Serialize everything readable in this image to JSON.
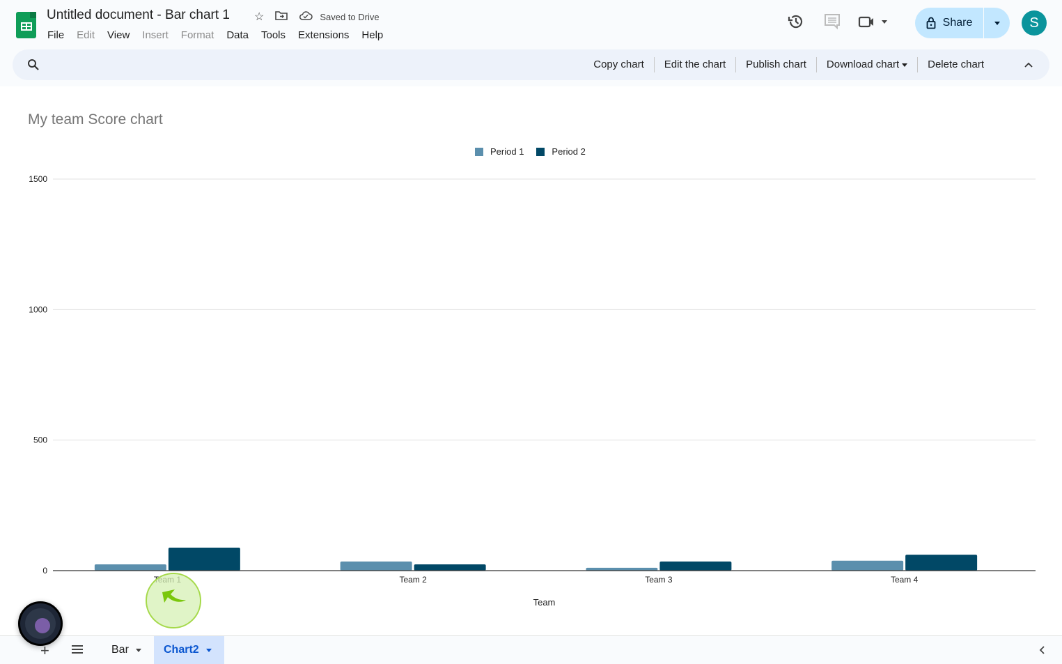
{
  "app": {
    "doc_title": "Untitled document - Bar chart 1",
    "saved_status": "Saved to Drive",
    "menu": [
      {
        "label": "File",
        "disabled": false
      },
      {
        "label": "Edit",
        "disabled": true
      },
      {
        "label": "View",
        "disabled": false
      },
      {
        "label": "Insert",
        "disabled": true
      },
      {
        "label": "Format",
        "disabled": true
      },
      {
        "label": "Data",
        "disabled": false
      },
      {
        "label": "Tools",
        "disabled": false
      },
      {
        "label": "Extensions",
        "disabled": false
      },
      {
        "label": "Help",
        "disabled": false
      }
    ],
    "share_label": "Share",
    "avatar_initial": "S",
    "avatar_color": "#0b949c"
  },
  "chart_toolbar": {
    "copy": "Copy chart",
    "edit": "Edit the chart",
    "publish": "Publish chart",
    "download": "Download chart",
    "delete": "Delete chart"
  },
  "sheets": {
    "tabs": [
      {
        "label": "Bar",
        "active": false
      },
      {
        "label": "Chart2",
        "active": true
      }
    ]
  },
  "chart_data": {
    "type": "bar",
    "title": "My team Score chart",
    "xlabel": "Team",
    "ylabel": "",
    "categories": [
      "Team 1",
      "Team 2",
      "Team 3",
      "Team 4"
    ],
    "series": [
      {
        "name": "Period 1",
        "color": "#5b8fad",
        "values": [
          24,
          35,
          11,
          38
        ]
      },
      {
        "name": "Period 2",
        "color": "#014866",
        "values": [
          88,
          24,
          35,
          61
        ]
      }
    ],
    "ylim": [
      0,
      1500
    ],
    "yticks": [
      0,
      500,
      1000,
      1500
    ],
    "grid": true,
    "legend_position": "top"
  }
}
